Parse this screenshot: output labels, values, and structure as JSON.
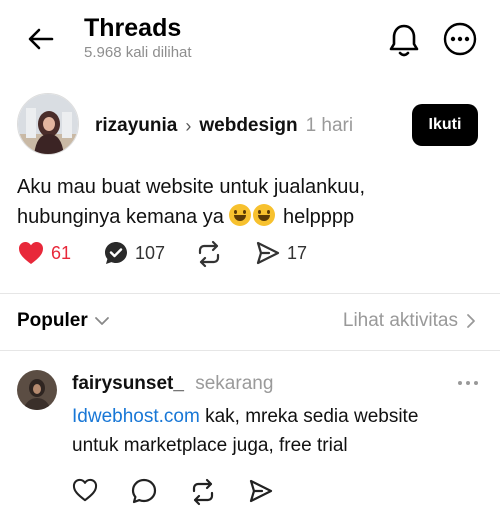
{
  "header": {
    "title": "Threads",
    "views": "5.968 kali dilihat"
  },
  "post": {
    "author": "rizayunia",
    "topic": "webdesign",
    "time": "1 hari",
    "follow_label": "Ikuti",
    "text_line1": "Aku mau buat website untuk jualankuu,",
    "text_line2": "hubunginya kemana ya",
    "text_line2_end": "helpppp",
    "likes": "61",
    "comments": "107",
    "shares": "17"
  },
  "sort": {
    "label": "Populer",
    "activity_label": "Lihat aktivitas"
  },
  "reply": {
    "author": "fairysunset_",
    "time": "sekarang",
    "link_text": "Idwebhost.com",
    "text_after_link": " kak, mreka sedia website",
    "text_line2": "untuk marketplace juga, free trial"
  },
  "colors": {
    "like_red": "#e8283a",
    "link_blue": "#1877d6",
    "muted_gray": "#999999",
    "follow_bg": "#000000"
  },
  "icons": [
    "back-arrow-icon",
    "bell-icon",
    "more-icon",
    "heart-icon",
    "comment-check-icon",
    "repost-icon",
    "send-icon",
    "chevron-down-icon",
    "chevron-right-icon"
  ]
}
